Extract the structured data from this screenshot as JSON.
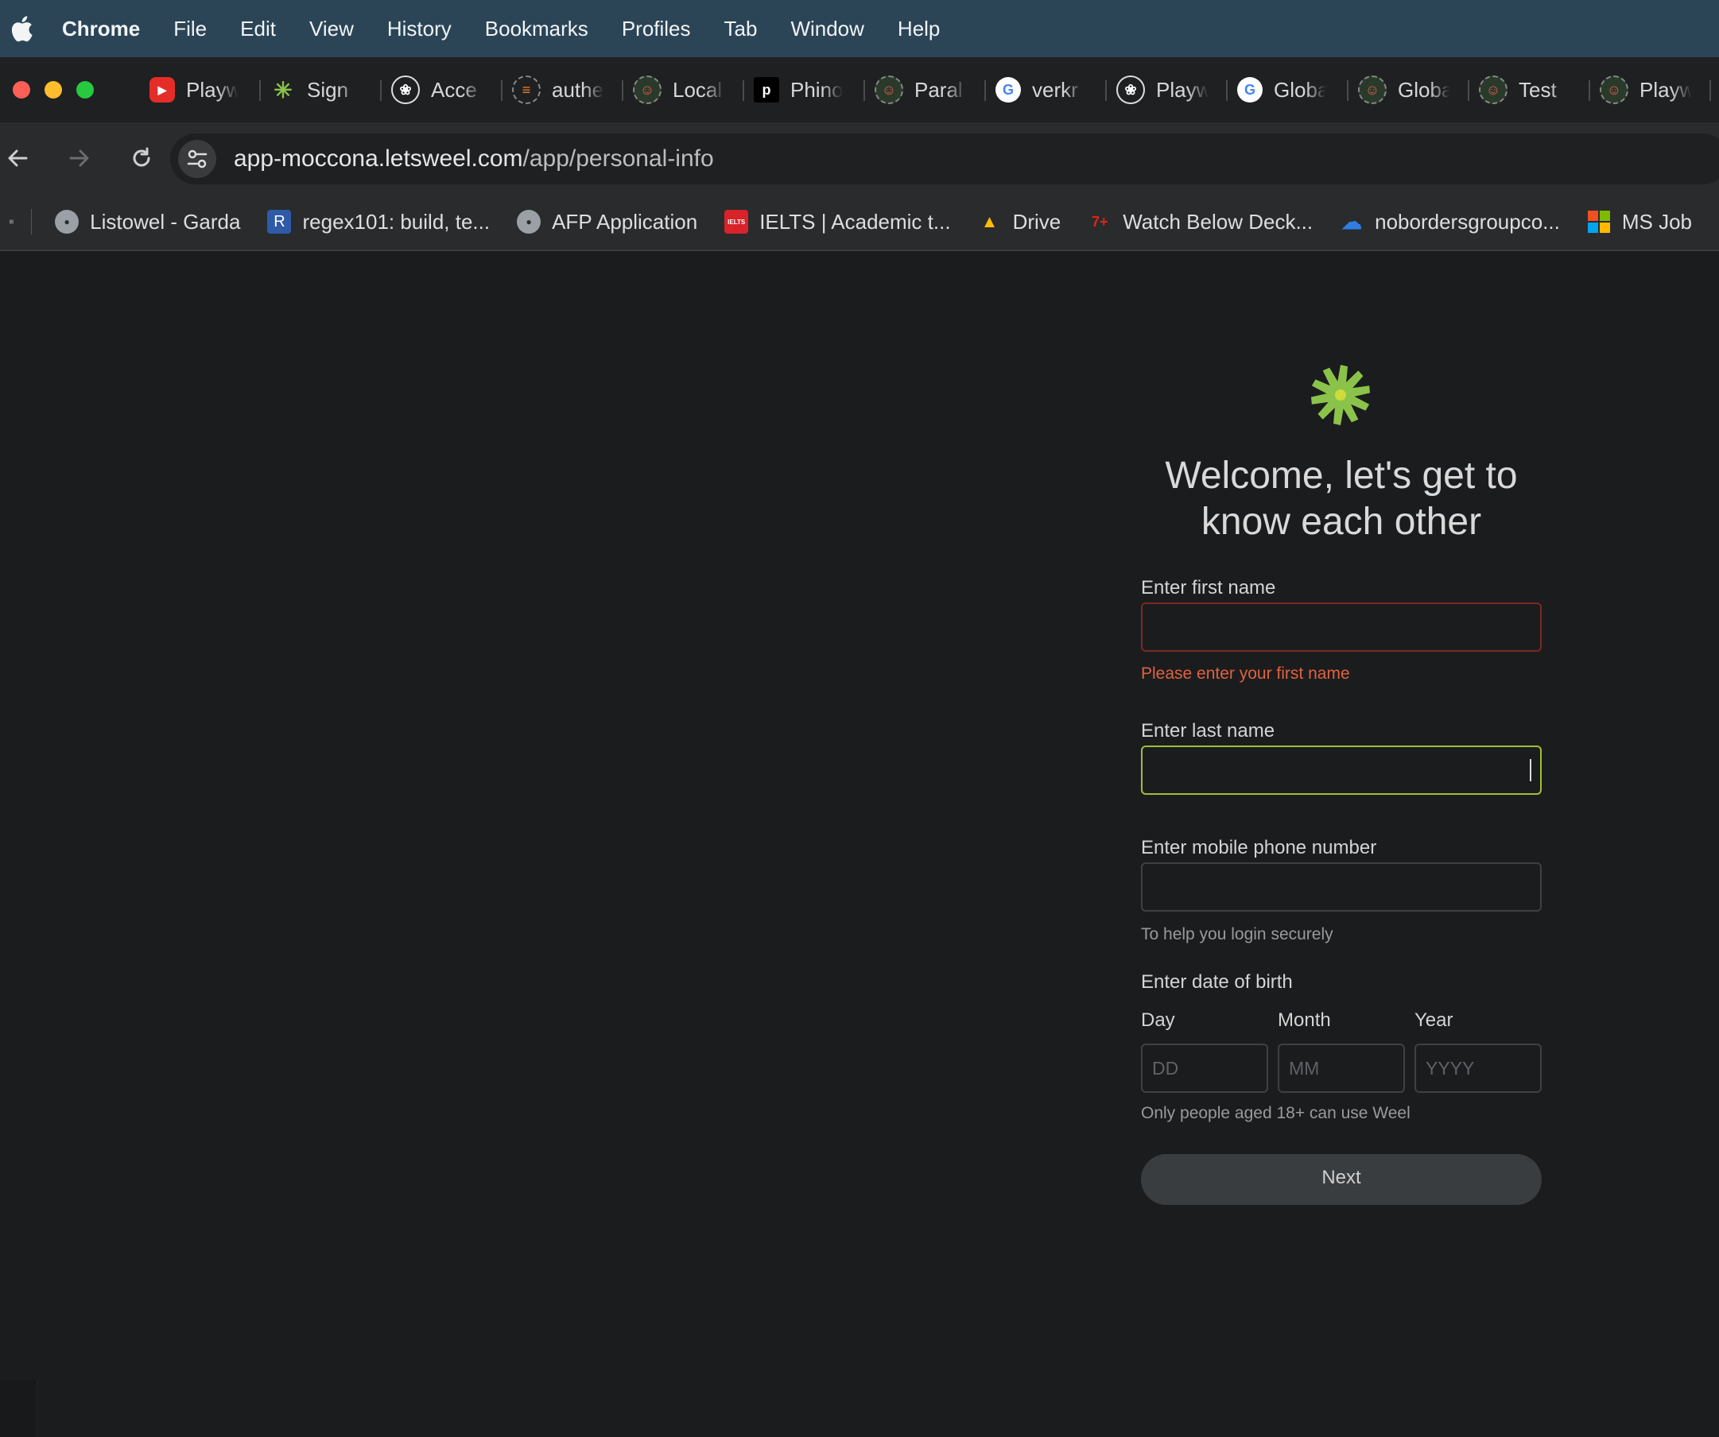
{
  "menubar": {
    "app": "Chrome",
    "items": [
      "File",
      "Edit",
      "View",
      "History",
      "Bookmarks",
      "Profiles",
      "Tab",
      "Window",
      "Help"
    ]
  },
  "tabs": [
    {
      "label": "Playw",
      "icon": "youtube-icon",
      "color": "#e52d27"
    },
    {
      "label": "Sign",
      "icon": "weel-logo-icon",
      "color": "#8bc34a"
    },
    {
      "label": "Acce",
      "icon": "openai-icon",
      "color": "#1f2022"
    },
    {
      "label": "authe",
      "icon": "stackoverflow-icon",
      "color": "#f48024"
    },
    {
      "label": "Local",
      "icon": "theater-masks-icon",
      "color": "#3b7b3b"
    },
    {
      "label": "Phino",
      "icon": "p-icon",
      "color": "#000000"
    },
    {
      "label": "Paral",
      "icon": "theater-masks-icon",
      "color": "#3b7b3b"
    },
    {
      "label": "verkr",
      "icon": "google-icon",
      "color": "#ffffff"
    },
    {
      "label": "Playw",
      "icon": "openai-icon",
      "color": "#1f2022"
    },
    {
      "label": "Globa",
      "icon": "google-icon",
      "color": "#ffffff"
    },
    {
      "label": "Globa",
      "icon": "theater-masks-icon",
      "color": "#3b7b3b"
    },
    {
      "label": "Test",
      "icon": "theater-masks-icon",
      "color": "#3b7b3b"
    },
    {
      "label": "Playw",
      "icon": "theater-masks-icon",
      "color": "#3b7b3b"
    }
  ],
  "address": {
    "host": "app-moccona.letsweel.com",
    "path": "/app/personal-info"
  },
  "bookmarks": [
    {
      "label": "Listowel - Garda",
      "icon": "globe-icon",
      "color": "#9aa0a6"
    },
    {
      "label": "regex101: build, te...",
      "icon": "r-icon",
      "color": "#2f5aa8"
    },
    {
      "label": "AFP Application",
      "icon": "globe-icon",
      "color": "#9aa0a6"
    },
    {
      "label": "IELTS | Academic t...",
      "icon": "ielts-icon",
      "color": "#d8232a"
    },
    {
      "label": "Drive",
      "icon": "google-drive-icon",
      "color": "#34a853"
    },
    {
      "label": "Watch Below Deck...",
      "icon": "seven-plus-icon",
      "color": "#e2231a"
    },
    {
      "label": "nobordersgroupco...",
      "icon": "onedrive-icon",
      "color": "#2f7de1"
    },
    {
      "label": "MS Job",
      "icon": "microsoft-icon",
      "color": "#f25022"
    }
  ],
  "form": {
    "heading_line1": "Welcome, let's get to",
    "heading_line2": "know each other",
    "first_name": {
      "label": "Enter first name",
      "value": "",
      "error": "Please enter your first name"
    },
    "last_name": {
      "label": "Enter last name",
      "value": ""
    },
    "phone": {
      "label": "Enter mobile phone number",
      "value": "",
      "hint": "To help you login securely"
    },
    "dob": {
      "label": "Enter date of birth",
      "day_label": "Day",
      "day_placeholder": "DD",
      "month_label": "Month",
      "month_placeholder": "MM",
      "year_label": "Year",
      "year_placeholder": "YYYY",
      "hint": "Only people aged 18+ can use Weel"
    },
    "next_label": "Next"
  },
  "colors": {
    "menubar_bg": "#2b4557",
    "error": "#e0623f",
    "focus_border": "#9fbf3a",
    "logo_green": "#8bc34a"
  }
}
